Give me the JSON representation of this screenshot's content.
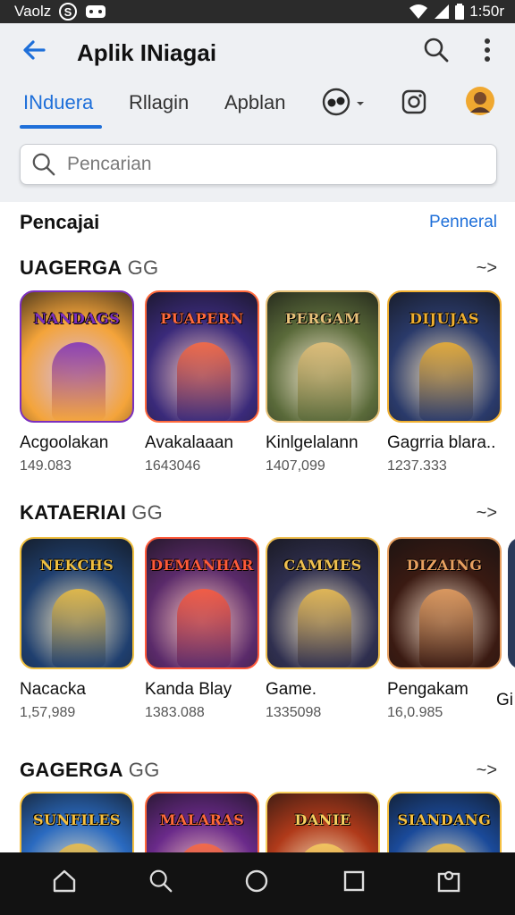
{
  "status": {
    "left_text": "Vaolz",
    "time": "1:50r"
  },
  "app": {
    "title": "Aplik INiagai"
  },
  "tabs": [
    {
      "label": "INduera",
      "active": true
    },
    {
      "label": "Rllagin",
      "active": false
    },
    {
      "label": "Apblan",
      "active": false
    }
  ],
  "search": {
    "placeholder": "Pencarian"
  },
  "top": {
    "heading": "Pencajai",
    "link": "Penneral"
  },
  "sections": [
    {
      "title": "UAGERGA",
      "badge": "GG",
      "arrow": "~>",
      "items": [
        {
          "tile_text": "NANDAGS",
          "name": "Acgoolakan",
          "count": "149.083",
          "bg": "#f4a43a",
          "accent": "#7b2fbe"
        },
        {
          "tile_text": "PUAPERN",
          "name": "Avakalaaan",
          "count": "1643046",
          "bg": "#3a2a7a",
          "accent": "#ff6a3d"
        },
        {
          "tile_text": "PERGAM",
          "name": "Kinlgelalann",
          "count": "1407,099",
          "bg": "#5a6a3a",
          "accent": "#e8c27a"
        },
        {
          "tile_text": "DIJUJAS",
          "name": "Gagrria blara..",
          "count": "1237.333",
          "bg": "#2a3a6a",
          "accent": "#f0b030"
        }
      ]
    },
    {
      "title": "KATAERIAI",
      "badge": "GG",
      "arrow": "~>",
      "items": [
        {
          "tile_text": "NEKCHS",
          "name": "Nacacka",
          "count": "1,57,989",
          "bg": "#1f3f6f",
          "accent": "#f0c040"
        },
        {
          "tile_text": "DEMANHAR",
          "name": "Kanda Blay",
          "count": "1383.088",
          "bg": "#5a2a6a",
          "accent": "#ff5a3a"
        },
        {
          "tile_text": "CAMMES",
          "name": "Game.",
          "count": "1335098",
          "bg": "#2f2f4f",
          "accent": "#f0c050"
        },
        {
          "tile_text": "DIZAING",
          "name": "Pengakam",
          "count": "16,0.985",
          "bg": "#3a1a12",
          "accent": "#e8a060"
        }
      ]
    },
    {
      "title": "GAGERGA",
      "badge": "GG",
      "arrow": "~>",
      "items": [
        {
          "tile_text": "SUNFILES",
          "name": "",
          "count": "",
          "bg": "#2a6ac0",
          "accent": "#f5c040"
        },
        {
          "tile_text": "MALARAS",
          "name": "",
          "count": "",
          "bg": "#6a2a8a",
          "accent": "#ff6a3a"
        },
        {
          "tile_text": "DANIE",
          "name": "",
          "count": "",
          "bg": "#b03a1a",
          "accent": "#f7d060"
        },
        {
          "tile_text": "SIANDANG",
          "name": "",
          "count": "",
          "bg": "#1a4a9a",
          "accent": "#f5c040"
        }
      ]
    }
  ],
  "row2_peek_name": "Gi"
}
